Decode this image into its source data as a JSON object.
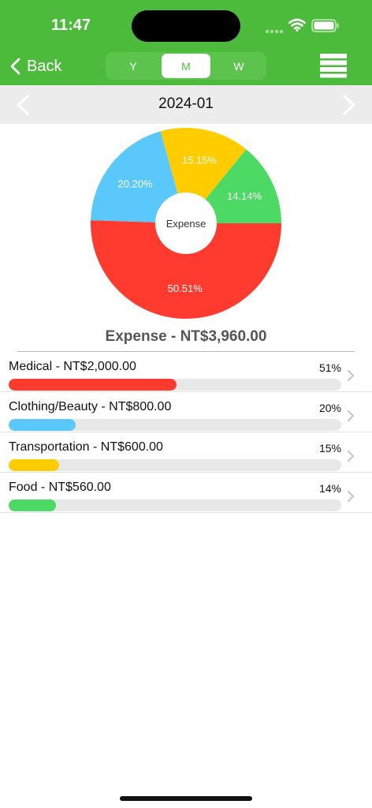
{
  "status_bar": {
    "time": "11:47"
  },
  "nav": {
    "back_label": "Back",
    "segments": [
      {
        "label": "Y"
      },
      {
        "label": "M",
        "selected": true
      },
      {
        "label": "W"
      }
    ],
    "menu_icon": "hamburger-icon"
  },
  "period": {
    "label": "2024-01"
  },
  "chart_data": {
    "type": "pie",
    "title": "",
    "center_label": "Expense",
    "slices": [
      {
        "label": "Medical",
        "value": 2000,
        "percent_label": "50.51%",
        "color": "#ff3b30"
      },
      {
        "label": "Clothing/Beauty",
        "value": 800,
        "percent_label": "20.20%",
        "color": "#5ac8fa"
      },
      {
        "label": "Transportation",
        "value": 600,
        "percent_label": "15.15%",
        "color": "#ffcc00"
      },
      {
        "label": "Food",
        "value": 560,
        "percent_label": "14.14%",
        "color": "#4cd964"
      }
    ]
  },
  "total": {
    "label": "Expense - NT$3,960.00"
  },
  "categories": [
    {
      "label": "Medical - NT$2,000.00",
      "percent": "51%",
      "fill": 0.5051,
      "color": "#ff3b30"
    },
    {
      "label": "Clothing/Beauty - NT$800.00",
      "percent": "20%",
      "fill": 0.202,
      "color": "#5ac8fa"
    },
    {
      "label": "Transportation - NT$600.00",
      "percent": "15%",
      "fill": 0.1515,
      "color": "#ffcc00"
    },
    {
      "label": "Food - NT$560.00",
      "percent": "14%",
      "fill": 0.1414,
      "color": "#4cd964"
    }
  ],
  "colors": {
    "header_green": "#4cbb3c",
    "month_bar_gray": "#ececec"
  }
}
